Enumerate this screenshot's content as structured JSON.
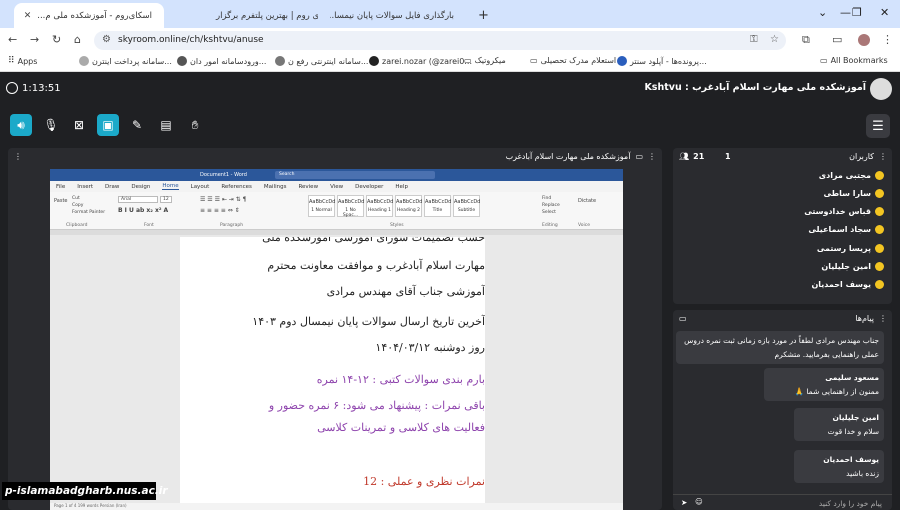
{
  "browser": {
    "tabs": [
      {
        "title": "اسکای‌روم - آموزشکده ملی م..."
      },
      {
        "title": "اسکای روم | بهترین پلتفرم برگزار..."
      },
      {
        "title": "بارگذاری فایل سوالات پایان نیمسا..."
      }
    ],
    "new_tab": "+",
    "url": "skyroom.online/ch/kshtvu/anuse",
    "bookmarks": [
      {
        "label": "Apps"
      },
      {
        "label": "سامانه پرداخت اینترن..."
      },
      {
        "label": "ورودسامانه امور دان..."
      },
      {
        "label": "سامانه اینترنتی رفع ن..."
      },
      {
        "label": "zarei.nozar (@zarei0..."
      },
      {
        "label": "میکروتیک"
      },
      {
        "label": "استعلام مدرک تحصیلی"
      },
      {
        "label": "پرونده‌ها - آپلود سنتر..."
      },
      {
        "label": "All Bookmarks"
      }
    ]
  },
  "app": {
    "timer": "1:13:51",
    "room_title": "Kshtvu : آموزشکده ملی مهارت اسلام آباد‌غرب",
    "screen_header": "آموزشکده ملی مهارت اسلام آبادغرب",
    "tools": [
      "speaker",
      "mic-off",
      "camera-off",
      "screen-share",
      "pen",
      "clipboard",
      "hand"
    ]
  },
  "word": {
    "doc_title": "Document1 - Word",
    "menus": [
      "File",
      "Insert",
      "Draw",
      "Design",
      "Home",
      "Layout",
      "References",
      "Mailings",
      "Review",
      "View",
      "Developer",
      "Help"
    ],
    "selected_menu": "Home",
    "font": "Arial",
    "size": "12",
    "styles": [
      "1 Normal",
      "1 No Spac...",
      "Heading 1",
      "Heading 2",
      "Title",
      "Subtitle"
    ],
    "groups": [
      "Clipboard",
      "Font",
      "Paragraph",
      "Styles",
      "Editing",
      "Voice"
    ],
    "paste": "Paste",
    "cut": "Cut",
    "copy": "Copy",
    "format_painter": "Format Painter",
    "find": "Find",
    "replace": "Replace",
    "select": "Select",
    "dictate": "Dictate",
    "search": "Search",
    "status": "Page 1 of 4    199 words    Persian (Iran)",
    "doc_lines": [
      {
        "text": "حسب تصمیمات شورای آموزشی آموزشکده ملی",
        "color": "#222"
      },
      {
        "text": "مهارت اسلام آبادغرب و موافقت معاونت محترم",
        "color": "#222"
      },
      {
        "text": "آموزشی جناب آقای مهندس مرادی",
        "color": "#222"
      },
      {
        "text": "آخرین تاریخ ارسال سوالات پایان نیمسال دوم ۱۴۰۳",
        "color": "#222"
      },
      {
        "text": "روز دوشنبه ۱۴۰۴/۰۳/۱۲",
        "color": "#222"
      },
      {
        "text": "بارم بندی سوالات کتبی : ۱۲-۱۴ نمره",
        "color": "#8e44ad"
      },
      {
        "text": "باقی نمرات : پیشنهاد می شود: ۶ نمره حضور و",
        "color": "#8e44ad"
      },
      {
        "text": "فعالیت های کلاسی و تمرینات کلاسی",
        "color": "#8e44ad"
      },
      {
        "text": "نمرات نظری و عملی :  12",
        "color": "#c0392b"
      }
    ]
  },
  "watermark": "p-islamabadgharb.nus.ac.ir",
  "users": {
    "title": "کاربران",
    "count": "21",
    "raised": "1",
    "list": [
      "مجتبی مرادی",
      "سارا ساطی",
      "قباس خدادوستی",
      "سجاد اسماعیلی",
      "پریسا رستمی",
      "امین جلیلیان",
      "یوسف احمدیان"
    ]
  },
  "messages": {
    "title": "پیام‌ها",
    "items": [
      {
        "name": "",
        "text": "جناب مهندس مرادی لطفاً در مورد بازه زمانی ثبت نمره دروس عملی راهنمایی بفرمایید. متشکرم"
      },
      {
        "name": "مسعود سلیمی",
        "text": "ممنون از راهنمایی شما 🙏"
      },
      {
        "name": "امین جلیلیان",
        "text": "سلام و خدا قوت"
      },
      {
        "name": "یوسف احمدیان",
        "text": "زنده باشید"
      }
    ],
    "placeholder": "پیام خود را وارد کنید"
  },
  "colors": {
    "accent": "#1ba9c9",
    "word_blue": "#2b579a",
    "panel": "#2a2b2f",
    "bg": "#1f2023"
  }
}
